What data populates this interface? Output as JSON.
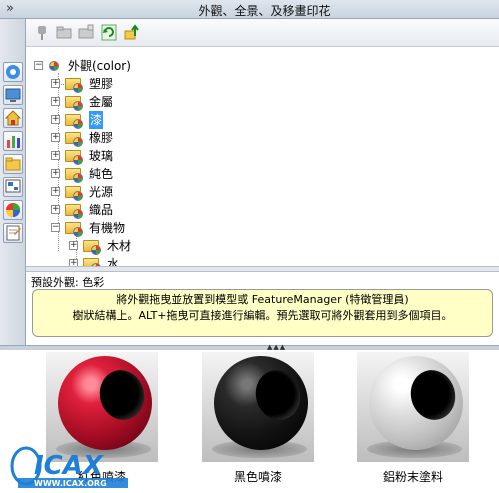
{
  "panel": {
    "title": "外觀、全景、及移畫印花",
    "collapse_glyph": "»"
  },
  "toolbar": {
    "icons": [
      "brush-icon",
      "open-folder-icon",
      "new-folder-icon",
      "refresh-icon",
      "move-up-icon"
    ]
  },
  "sidebar": {
    "icons": [
      "design-library-icon",
      "screen-icon",
      "home-icon",
      "properties-icon",
      "folder-icon",
      "view-palette-icon",
      "appearance-icon",
      "custom-properties-icon"
    ]
  },
  "tree": {
    "root": {
      "label": "外觀(color)",
      "expanded": true
    },
    "items": [
      {
        "label": "塑膠",
        "selected": false
      },
      {
        "label": "金屬",
        "selected": false
      },
      {
        "label": "漆",
        "selected": true
      },
      {
        "label": "橡膠",
        "selected": false
      },
      {
        "label": "玻璃",
        "selected": false
      },
      {
        "label": "純色",
        "selected": false
      },
      {
        "label": "光源",
        "selected": false
      },
      {
        "label": "織品",
        "selected": false
      },
      {
        "label": "有機物",
        "selected": false,
        "expanded": true
      }
    ],
    "subitems": [
      {
        "label": "木材"
      },
      {
        "label": "水"
      }
    ]
  },
  "info": {
    "label": "預設外觀: 色彩",
    "tip_line1": "將外觀拖曳並放置到模型或 FeatureManager (特徵管理員)",
    "tip_line2": "樹狀結構上。ALT+拖曳可直接進行編輯。預先選取可將外觀套用到多個項目。"
  },
  "gallery": {
    "items": [
      {
        "label": "紅色噴漆",
        "color": "#c8102e"
      },
      {
        "label": "黑色噴漆",
        "color": "#1a1a1a"
      },
      {
        "label": "鋁粉末塗料",
        "color": "#d4d4d4"
      }
    ]
  },
  "watermark": {
    "text": "ICAX",
    "subtext": "WWW.ICAX.ORG"
  }
}
